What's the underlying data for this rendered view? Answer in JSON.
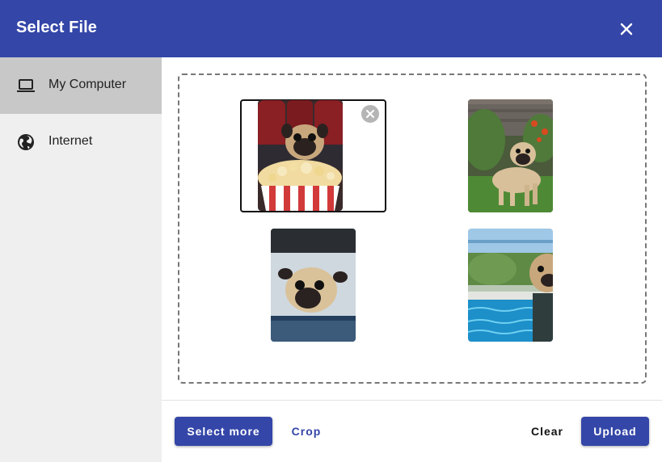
{
  "dialog": {
    "title": "Select File",
    "close_icon": "close-icon"
  },
  "sidebar": {
    "items": [
      {
        "label": "My Computer",
        "icon": "laptop-icon",
        "active": true
      },
      {
        "label": "Internet",
        "icon": "globe-icon",
        "active": false
      }
    ]
  },
  "gallery": {
    "images": [
      {
        "subject": "pug with popcorn bucket in cinema",
        "selected": true
      },
      {
        "subject": "pug standing on grass",
        "selected": false
      },
      {
        "subject": "pug peeking out of car window",
        "selected": false
      },
      {
        "subject": "pug by swimming pool",
        "selected": false
      }
    ]
  },
  "footer": {
    "select_more_label": "Select more",
    "crop_label": "Crop",
    "clear_label": "Clear",
    "upload_label": "Upload"
  },
  "colors": {
    "primary": "#3446a8",
    "sidebar_bg": "#efefef",
    "sidebar_active": "#c8c8c8"
  }
}
